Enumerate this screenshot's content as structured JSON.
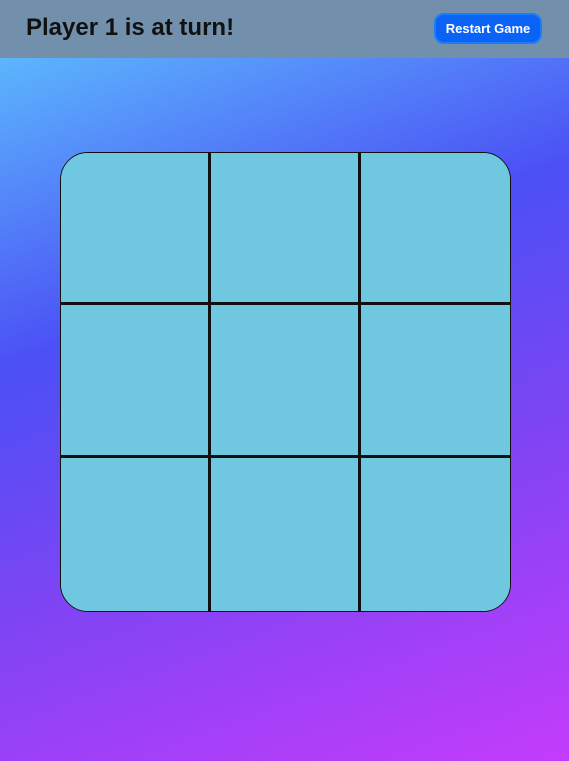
{
  "header": {
    "status_text": "Player 1 is at turn!",
    "restart_label": "Restart Game"
  },
  "board": {
    "cells": [
      "",
      "",
      "",
      "",
      "",
      "",
      "",
      "",
      ""
    ]
  },
  "colors": {
    "header_bg": "#7290ac",
    "button_bg": "#0b63f6",
    "cell_bg": "#6fc8e0",
    "grid_line": "#111111"
  }
}
